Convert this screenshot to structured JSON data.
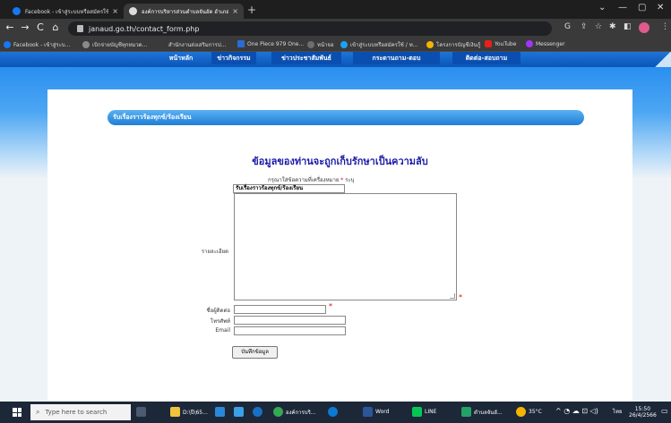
{
  "browser": {
    "tabs": [
      {
        "title": "Facebook - เข้าสู่ระบบหรือสมัครใช้งาน",
        "favicon_color": "#1877f2",
        "active": false
      },
      {
        "title": "องค์การบริหารส่วนตำบลจันอัด อำเภอโนนสูง",
        "favicon_color": "#4a4a4a",
        "active": true
      }
    ],
    "new_tab": "+",
    "window_controls": [
      "⌄",
      "—",
      "▢",
      "✕"
    ],
    "nav": {
      "back": "←",
      "forward": "→",
      "reload": "C",
      "home": "⌂"
    },
    "url": "janaud.go.th/contact_form.php",
    "toolbar_icons": [
      "G",
      "⇪",
      "☆",
      "✱",
      "◧",
      "⋮"
    ],
    "bookmarks": [
      {
        "label": "Facebook - เข้าสู่ระบ...",
        "color": "#1877f2"
      },
      {
        "label": "เบิกจ่ายบัญชีทุกหมวด...",
        "color": "#8a8a8a"
      },
      {
        "label": "สำนักงานส่งเสริมการป...",
        "color": "#4a8c3a"
      },
      {
        "label": "One Piece 979 One...",
        "color": "#2a6bd6"
      },
      {
        "label": "หน้าจอ",
        "color": "#6e6e6e"
      },
      {
        "label": "เข้าสู่ระบบหรือสมัครใช้ / ท...",
        "color": "#1da1f2"
      },
      {
        "label": "โครงการบัญชีเงินกู้",
        "color": "#f4b400"
      },
      {
        "label": "YouTube",
        "color": "#e62117"
      },
      {
        "label": "Messenger",
        "color": "#a334fa"
      }
    ]
  },
  "site": {
    "nav": [
      "หน้าหลัก",
      "ข่าวกิจกรรม",
      "ข่าวประชาสัมพันธ์",
      "กระดานถาม-ตอบ",
      "ติดต่อ-สอบถาม"
    ],
    "section_title": "รับเรื่องราวร้องทุกข์/ร้องเรียน",
    "headline": "ข้อมูลของท่านจะถูกเก็บรักษาเป็นความลับ",
    "form": {
      "note": "กรุณาใส่ข้อความที่เครื่องหมาย",
      "note_star": "*",
      "note_suffix": "ระบุ",
      "subject_value": "รับเรื่องราวร้องทุกข์/ร้องเรียน",
      "detail_label": "รายละเอียด",
      "name_label": "ชื่อผู้ติดต่อ",
      "phone_label": "โทรศัพท์",
      "email_label": "Email",
      "required_mark": "*",
      "submit_label": "บันทึกข้อมูล"
    }
  },
  "taskbar": {
    "search_placeholder": "Type here to search",
    "items": [
      {
        "label": "D:\\ปี\\65...",
        "color": "#f0c33c"
      },
      {
        "label": "",
        "color": "#2b88d8"
      },
      {
        "label": "",
        "color": "#3ca0e8"
      },
      {
        "label": "",
        "color": "#1a6fc4"
      },
      {
        "label": "องค์การบริ...",
        "color": "#34a853"
      },
      {
        "label": "",
        "color": "#0a7ad4"
      },
      {
        "label": "Word",
        "color": "#2b579a"
      },
      {
        "label": "LINE",
        "color": "#06c755"
      },
      {
        "label": "ตำบลจันอั...",
        "color": "#21a366"
      }
    ],
    "weather": "35°C",
    "language": "ไทย",
    "time": "15:50",
    "date": "26/4/2566"
  }
}
